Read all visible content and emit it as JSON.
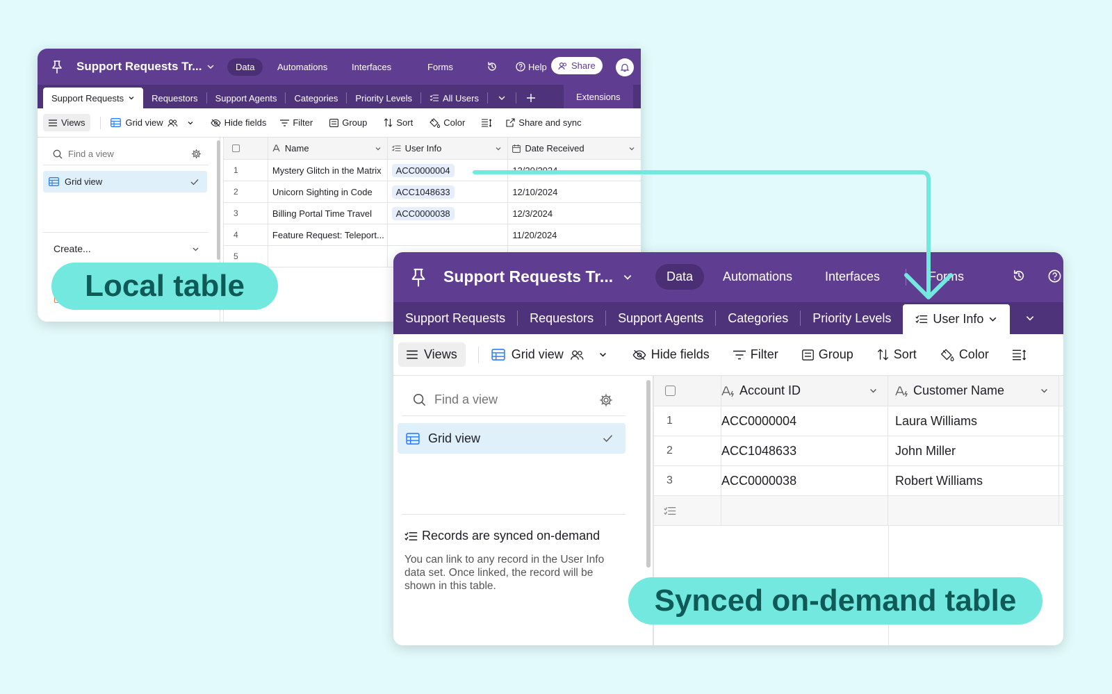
{
  "base_title": "Support Requests Tr...",
  "nav": {
    "data": "Data",
    "automations": "Automations",
    "interfaces": "Interfaces",
    "forms": "Forms",
    "help": "Help",
    "share": "Share"
  },
  "local": {
    "tabs": [
      "Support Requests",
      "Requestors",
      "Support Agents",
      "Categories",
      "Priority Levels",
      "All Users"
    ],
    "extensions": "Extensions",
    "toolbar": {
      "views": "Views",
      "grid_view": "Grid view",
      "hide_fields": "Hide fields",
      "filter": "Filter",
      "group": "Group",
      "sort": "Sort",
      "color": "Color",
      "share_sync": "Share and sync"
    },
    "sidebar": {
      "find_placeholder": "Find a view",
      "grid_view": "Grid view",
      "create": "Create..."
    },
    "columns": [
      "Name",
      "User Info",
      "Date Received"
    ],
    "rows": [
      {
        "n": "1",
        "name": "Mystery Glitch in the Matrix",
        "user": "ACC0000004",
        "date": "12/20/2024"
      },
      {
        "n": "2",
        "name": "Unicorn Sighting in Code",
        "user": "ACC1048633",
        "date": "12/10/2024"
      },
      {
        "n": "3",
        "name": "Billing Portal Time Travel",
        "user": "ACC0000038",
        "date": "12/3/2024"
      },
      {
        "n": "4",
        "name": "Feature Request: Teleport...",
        "user": "",
        "date": "11/20/2024"
      },
      {
        "n": "5",
        "name": "",
        "user": "",
        "date": ""
      }
    ]
  },
  "synced": {
    "tabs": [
      "Support Requests",
      "Requestors",
      "Support Agents",
      "Categories",
      "Priority Levels",
      "User Info"
    ],
    "toolbar": {
      "views": "Views",
      "grid_view": "Grid view",
      "hide_fields": "Hide fields",
      "filter": "Filter",
      "group": "Group",
      "sort": "Sort",
      "color": "Color"
    },
    "sidebar": {
      "find_placeholder": "Find a view",
      "grid_view": "Grid view",
      "note_title": "Records are synced on-demand",
      "note_body": "You can link to any record in the User Info data set. Once linked, the record will be shown in this table."
    },
    "columns": [
      "Account ID",
      "Customer Name"
    ],
    "rows": [
      {
        "n": "1",
        "account": "ACC0000004",
        "customer": "Laura Williams"
      },
      {
        "n": "2",
        "account": "ACC1048633",
        "customer": "John Miller"
      },
      {
        "n": "3",
        "account": "ACC0000038",
        "customer": "Robert Williams"
      }
    ]
  },
  "labels": {
    "local": "Local table",
    "synced": "Synced on-demand table"
  },
  "colors": {
    "topbar": "#5f3e91",
    "tabbar": "#4f337a",
    "accent": "#72e8df",
    "background": "#e2fafb"
  }
}
